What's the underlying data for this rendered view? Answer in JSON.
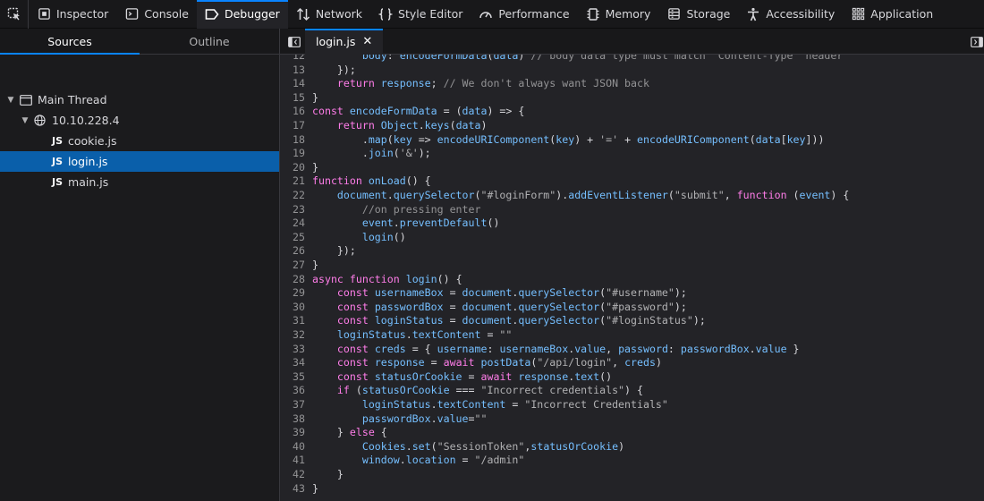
{
  "toolbar": {
    "tabs": [
      {
        "label": "Inspector",
        "icon": "inspector-icon"
      },
      {
        "label": "Console",
        "icon": "console-icon"
      },
      {
        "label": "Debugger",
        "icon": "debugger-icon"
      },
      {
        "label": "Network",
        "icon": "network-icon"
      },
      {
        "label": "Style Editor",
        "icon": "style-editor-icon"
      },
      {
        "label": "Performance",
        "icon": "performance-icon"
      },
      {
        "label": "Memory",
        "icon": "memory-icon"
      },
      {
        "label": "Storage",
        "icon": "storage-icon"
      },
      {
        "label": "Accessibility",
        "icon": "accessibility-icon"
      },
      {
        "label": "Application",
        "icon": "application-icon"
      }
    ],
    "active": "Debugger"
  },
  "sidebar": {
    "tabs": [
      "Sources",
      "Outline"
    ],
    "thread": "Main Thread",
    "host": "10.10.228.4",
    "files": [
      {
        "badge": "JS",
        "name": "cookie.js"
      },
      {
        "badge": "JS",
        "name": "login.js"
      },
      {
        "badge": "JS",
        "name": "main.js"
      }
    ],
    "selected_file": "login.js"
  },
  "editor": {
    "tab_label": "login.js",
    "close_glyph": "✕",
    "lines": [
      {
        "n": "12",
        "text": "        body: encodeFormData(data) // body data type must match \"Content-Type\" header"
      },
      {
        "n": "13",
        "text": "    });"
      },
      {
        "n": "14",
        "text": "    return response; // We don't always want JSON back"
      },
      {
        "n": "15",
        "text": "}"
      },
      {
        "n": "16",
        "text": "const encodeFormData = (data) => {"
      },
      {
        "n": "17",
        "text": "    return Object.keys(data)"
      },
      {
        "n": "18",
        "text": "        .map(key => encodeURIComponent(key) + '=' + encodeURIComponent(data[key]))"
      },
      {
        "n": "19",
        "text": "        .join('&');"
      },
      {
        "n": "20",
        "text": "}"
      },
      {
        "n": "21",
        "text": "function onLoad() {"
      },
      {
        "n": "22",
        "text": "    document.querySelector(\"#loginForm\").addEventListener(\"submit\", function (event) {"
      },
      {
        "n": "23",
        "text": "        //on pressing enter"
      },
      {
        "n": "24",
        "text": "        event.preventDefault()"
      },
      {
        "n": "25",
        "text": "        login()"
      },
      {
        "n": "26",
        "text": "    });"
      },
      {
        "n": "27",
        "text": "}"
      },
      {
        "n": "28",
        "text": "async function login() {"
      },
      {
        "n": "29",
        "text": "    const usernameBox = document.querySelector(\"#username\");"
      },
      {
        "n": "30",
        "text": "    const passwordBox = document.querySelector(\"#password\");"
      },
      {
        "n": "31",
        "text": "    const loginStatus = document.querySelector(\"#loginStatus\");"
      },
      {
        "n": "32",
        "text": "    loginStatus.textContent = \"\""
      },
      {
        "n": "33",
        "text": "    const creds = { username: usernameBox.value, password: passwordBox.value }"
      },
      {
        "n": "34",
        "text": "    const response = await postData(\"/api/login\", creds)"
      },
      {
        "n": "35",
        "text": "    const statusOrCookie = await response.text()"
      },
      {
        "n": "36",
        "text": "    if (statusOrCookie === \"Incorrect credentials\") {"
      },
      {
        "n": "37",
        "text": "        loginStatus.textContent = \"Incorrect Credentials\""
      },
      {
        "n": "38",
        "text": "        passwordBox.value=\"\""
      },
      {
        "n": "39",
        "text": "    } else {"
      },
      {
        "n": "40",
        "text": "        Cookies.set(\"SessionToken\",statusOrCookie)"
      },
      {
        "n": "41",
        "text": "        window.location = \"/admin\""
      },
      {
        "n": "42",
        "text": "    }"
      },
      {
        "n": "43",
        "text": "}"
      }
    ]
  }
}
